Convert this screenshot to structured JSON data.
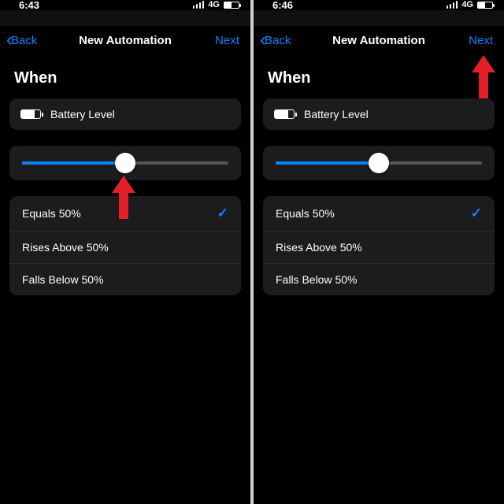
{
  "screens": [
    {
      "status_time": "6:43",
      "network_label": "4G",
      "nav_back": "Back",
      "nav_title": "New Automation",
      "nav_next": "Next",
      "section_when": "When",
      "battery_level_label": "Battery Level",
      "slider_percent": 50,
      "options": [
        {
          "label": "Equals 50%",
          "selected": true
        },
        {
          "label": "Rises Above 50%",
          "selected": false
        },
        {
          "label": "Falls Below 50%",
          "selected": false
        }
      ],
      "arrow_target": "slider-thumb"
    },
    {
      "status_time": "6:46",
      "network_label": "4G",
      "nav_back": "Back",
      "nav_title": "New Automation",
      "nav_next": "Next",
      "section_when": "When",
      "battery_level_label": "Battery Level",
      "slider_percent": 50,
      "options": [
        {
          "label": "Equals 50%",
          "selected": true
        },
        {
          "label": "Rises Above 50%",
          "selected": false
        },
        {
          "label": "Falls Below 50%",
          "selected": false
        }
      ],
      "arrow_target": "next-button"
    }
  ]
}
